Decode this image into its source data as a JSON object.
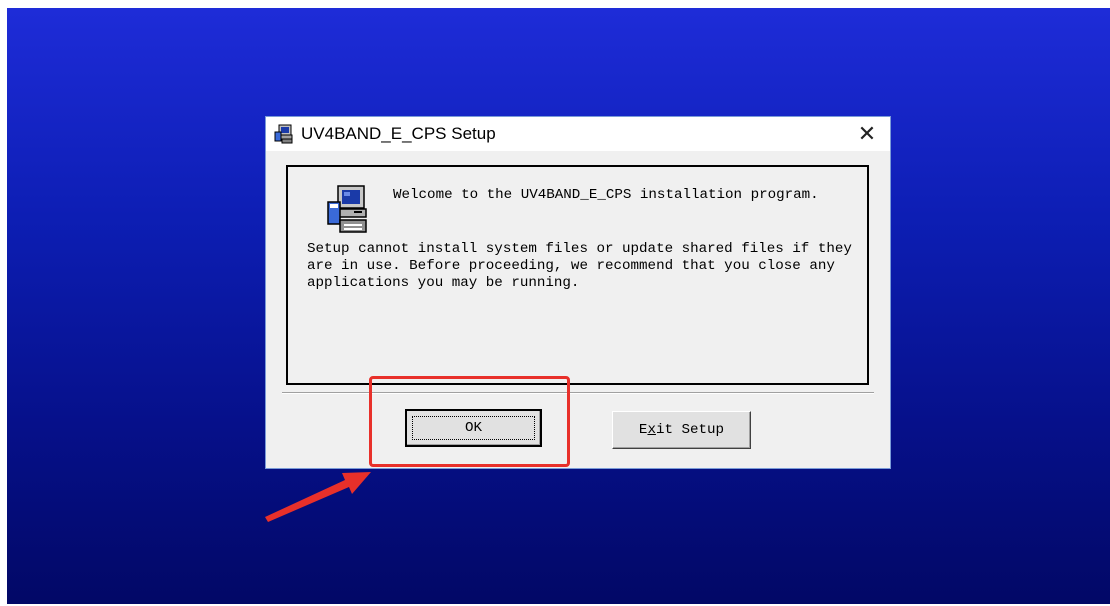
{
  "dialog": {
    "title": "UV4BAND_E_CPS Setup",
    "close_label": "✕",
    "welcome": "Welcome to the UV4BAND_E_CPS installation program.",
    "message": "Setup cannot install system files or update shared files if they are in use.  Before proceeding, we recommend that you close any applications you may be running.",
    "ok_label": "OK",
    "exit_label": {
      "pre": "E",
      "mnemonic": "x",
      "post": "it Setup"
    }
  },
  "icons": {
    "title_icon": "setup-computer-icon",
    "content_icon": "setup-computer-icon",
    "close_icon": "close-icon"
  },
  "annotation": {
    "highlight_color": "#e8302a",
    "arrow_color": "#e8302a"
  }
}
